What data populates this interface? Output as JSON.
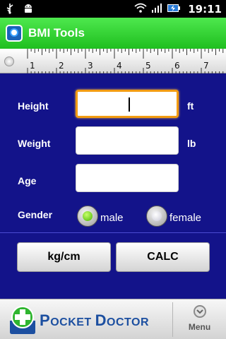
{
  "status_bar": {
    "time": "19:11",
    "icons": [
      "usb-icon",
      "android-debug-icon",
      "wifi-icon",
      "signal-icon",
      "battery-charging-icon"
    ]
  },
  "title_bar": {
    "title": "BMI Tools",
    "icon": "app-icon"
  },
  "ruler": {
    "ticks": [
      "1",
      "2",
      "3",
      "4",
      "5",
      "6",
      "7"
    ]
  },
  "form": {
    "height": {
      "label": "Height",
      "unit": "ft",
      "value": ""
    },
    "weight": {
      "label": "Weight",
      "unit": "lb",
      "value": ""
    },
    "age": {
      "label": "Age",
      "value": ""
    },
    "gender": {
      "label": "Gender",
      "options": [
        {
          "label": "male",
          "selected": true
        },
        {
          "label": "female",
          "selected": false
        }
      ]
    }
  },
  "buttons": {
    "units": "kg/cm",
    "calc": "CALC"
  },
  "bottom_bar": {
    "brand_small": "P",
    "brand_rest1": "OCKET ",
    "brand_d": "D",
    "brand_rest2": "OCTOR",
    "menu": "Menu"
  },
  "colors": {
    "title_green": "#2bcc2b",
    "panel_blue": "#13138a",
    "focus_orange": "#f39c12",
    "radio_selected": "#46b400",
    "brand_blue": "#1c4fa0"
  }
}
